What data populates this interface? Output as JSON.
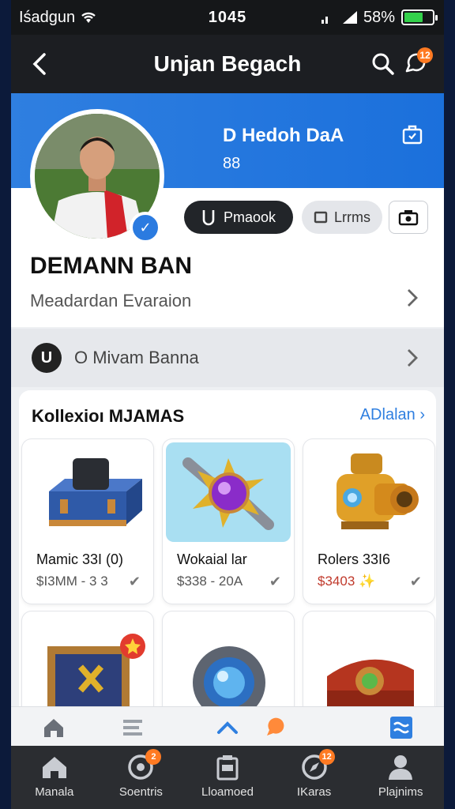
{
  "status_bar": {
    "carrier": "Iśadgun",
    "time": "1045",
    "battery": "58%"
  },
  "nav": {
    "title": "Unjan Begach"
  },
  "notification_badge": "12",
  "banner": {
    "title": "D Hedoh DaA",
    "count": "88"
  },
  "profile": {
    "remark_button": "Pmaook",
    "lums_button": "Lrrms",
    "name": "DEMANN BAN",
    "subtitle": "Meadardan Evaraion"
  },
  "row": {
    "icon_letter": "U",
    "label": "O Mivam Banna"
  },
  "collection": {
    "title": "Kollexioı MJAMAS",
    "view_all": "ADlalan",
    "items": [
      {
        "name": "Mamic 33I (0)",
        "price": "$I3MM - 3 3"
      },
      {
        "name": "Wokaial lar",
        "price": "$338 - 20A"
      },
      {
        "name": "Rolers 33I6",
        "price": "$3403 ✨"
      }
    ]
  },
  "bottom_nav": [
    {
      "label": "Manala"
    },
    {
      "label": "Soentris",
      "badge": "2"
    },
    {
      "label": "Lloamoed"
    },
    {
      "label": "IKaras",
      "badge": "12"
    },
    {
      "label": "Plajnims"
    }
  ],
  "colors": {
    "accent": "#2f7fe0",
    "badge": "#ff7a22",
    "dark": "#1c1e22"
  }
}
